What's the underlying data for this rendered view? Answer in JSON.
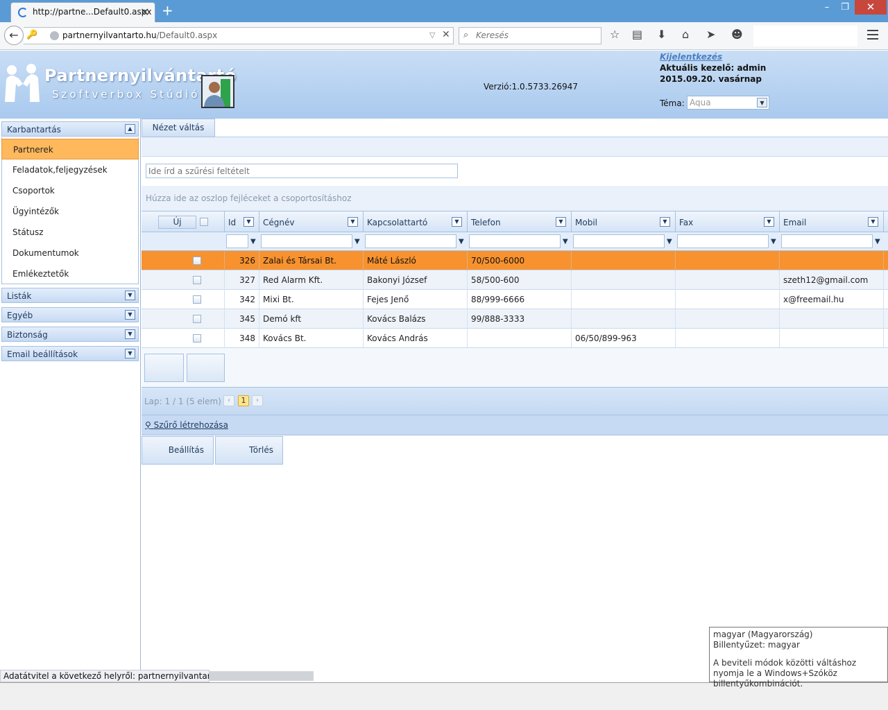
{
  "browser": {
    "tab_title": "http://partne...Default0.aspx",
    "url_host": "partnernyilvantarto.hu",
    "url_path": "/Default0.aspx",
    "search_placeholder": "Keresés"
  },
  "header": {
    "logo_title": "Partnernyilvántartó",
    "logo_subtitle": "Szoftverbox Stúdió",
    "version": "Verzió:1.0.5733.26947",
    "logout": "Kijelentkezés",
    "current_user": "Aktuális kezelő: admin",
    "date": "2015.09.20. vasárnap",
    "theme_label": "Téma:",
    "theme_value": "Aqua"
  },
  "sidebar": {
    "groups": [
      {
        "label": "Karbantartás"
      },
      {
        "label": "Listák"
      },
      {
        "label": "Egyéb"
      },
      {
        "label": "Biztonság"
      },
      {
        "label": "Email beállítások"
      }
    ],
    "items": [
      {
        "label": "Partnerek"
      },
      {
        "label": "Feladatok,feljegyzések"
      },
      {
        "label": "Csoportok"
      },
      {
        "label": "Ügyintézők"
      },
      {
        "label": "Státusz"
      },
      {
        "label": "Dokumentumok"
      },
      {
        "label": "Emlékeztetők"
      }
    ]
  },
  "main": {
    "view_switch": "Nézet váltás",
    "filter_placeholder": "Ide írd a szűrési feltételt",
    "group_hint": "Húzza ide az oszlop fejléceket a csoportosításhoz",
    "new_button": "Új",
    "columns": [
      "Id",
      "Cégnév",
      "Kapcsolattartó",
      "Telefon",
      "Mobil",
      "Fax",
      "Email"
    ],
    "rows": [
      {
        "id": "326",
        "company": "Zalai és Társai Bt.",
        "contact": "Máté László",
        "phone": "70/500-6000",
        "mobile": "",
        "fax": "",
        "email": ""
      },
      {
        "id": "327",
        "company": "Red Alarm Kft.",
        "contact": "Bakonyi József",
        "phone": "58/500-600",
        "mobile": "",
        "fax": "",
        "email": "szeth12@gmail.com"
      },
      {
        "id": "342",
        "company": "Mixi Bt.",
        "contact": "Fejes Jenő",
        "phone": "88/999-6666",
        "mobile": "",
        "fax": "",
        "email": "x@freemail.hu"
      },
      {
        "id": "345",
        "company": "Demó kft",
        "contact": "Kovács Balázs",
        "phone": "99/888-3333",
        "mobile": "",
        "fax": "",
        "email": ""
      },
      {
        "id": "348",
        "company": "Kovács Bt.",
        "contact": "Kovács András",
        "phone": "",
        "mobile": "06/50/899-963",
        "fax": "",
        "email": ""
      }
    ],
    "pager_info": "Lap: 1 / 1 (5 elem)",
    "pager_current": "1",
    "create_filter": "Szűrő létrehozása",
    "settings_button": "Beállítás",
    "delete_button": "Törlés"
  },
  "status": {
    "text": "Adatátvitel a következő helyről: partnernyilvantarto.hu..."
  },
  "tooltip": {
    "line1": "magyar (Magyarország)",
    "line2": "Billentyűzet: magyar",
    "line3": "A beviteli módok közötti váltáshoz nyomja le a Windows+Szóköz billentyűkombinációt."
  }
}
